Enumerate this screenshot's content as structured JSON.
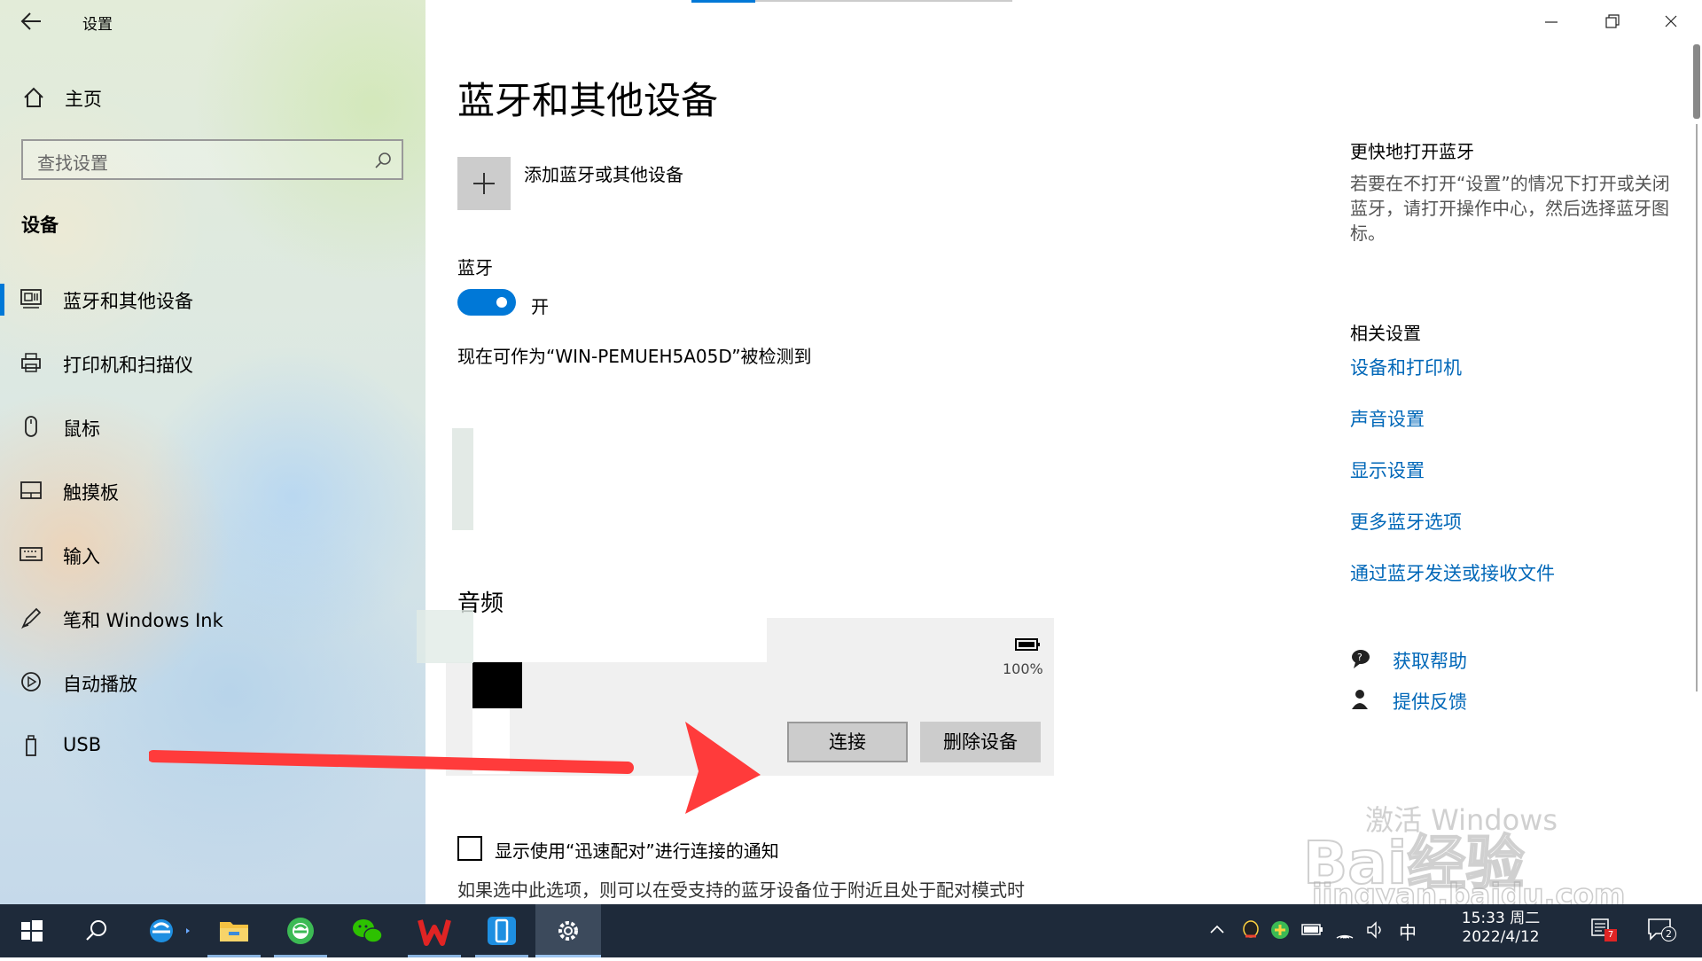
{
  "window": {
    "title": "设置"
  },
  "sidebar": {
    "home_label": "主页",
    "search_placeholder": "查找设置",
    "section_title": "设备",
    "items": [
      {
        "label": "蓝牙和其他设备",
        "icon": "bluetooth-devices-icon"
      },
      {
        "label": "打印机和扫描仪",
        "icon": "printer-icon"
      },
      {
        "label": "鼠标",
        "icon": "mouse-icon"
      },
      {
        "label": "触摸板",
        "icon": "touchpad-icon"
      },
      {
        "label": "输入",
        "icon": "keyboard-icon"
      },
      {
        "label": "笔和 Windows Ink",
        "icon": "pen-icon"
      },
      {
        "label": "自动播放",
        "icon": "autoplay-icon"
      },
      {
        "label": "USB",
        "icon": "usb-icon"
      }
    ]
  },
  "main": {
    "title": "蓝牙和其他设备",
    "add_device_label": "添加蓝牙或其他设备",
    "bluetooth_heading": "蓝牙",
    "bluetooth_state": "开",
    "bluetooth_on": true,
    "discoverable_text": "现在可作为“WIN-PEMUEH5A05D”被检测到",
    "audio_heading": "音频",
    "device_battery": "100%",
    "connect_button": "连接",
    "remove_button": "删除设备",
    "swift_pair_checkbox_label": "显示使用“迅速配对”进行连接的通知",
    "swift_pair_checked": false,
    "swift_pair_desc": "如果选中此选项，则可以在受支持的蓝牙设备位于附近且处于配对模式时"
  },
  "right_panel": {
    "quick_title": "更快地打开蓝牙",
    "quick_desc": "若要在不打开“设置”的情况下打开或关闭蓝牙，请打开操作中心，然后选择蓝牙图标。",
    "related_title": "相关设置",
    "links": [
      "设备和打印机",
      "声音设置",
      "显示设置",
      "更多蓝牙选项",
      "通过蓝牙发送或接收文件"
    ],
    "help_label": "获取帮助",
    "feedback_label": "提供反馈"
  },
  "watermark": {
    "activate": "激活 Windows",
    "site": "jingyan.baidu.com",
    "brand": "Bai经验"
  },
  "taskbar": {
    "time": "15:33 周二",
    "date": "2022/4/12",
    "ime": "中",
    "notification_badge": "7",
    "chat_badge": "2"
  },
  "colors": {
    "accent": "#0067b8",
    "toggle_on": "#0078d7",
    "arrow": "#ff3b3b"
  }
}
